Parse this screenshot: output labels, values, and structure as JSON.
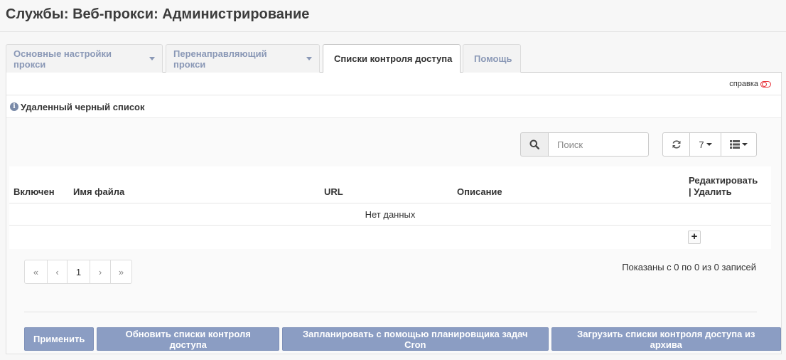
{
  "page": {
    "title": "Службы: Веб-прокси: Администрирование"
  },
  "tabs": [
    {
      "label": "Основные настройки прокси",
      "has_dropdown": true
    },
    {
      "label": "Перенаправляющий прокси",
      "has_dropdown": true
    },
    {
      "label": "Списки контроля доступа",
      "active": true
    },
    {
      "label": "Помощь"
    }
  ],
  "help": {
    "label": "справка"
  },
  "section": {
    "title": "Удаленный черный список"
  },
  "search": {
    "placeholder": "Поиск"
  },
  "toolbar": {
    "page_size": "7"
  },
  "grid": {
    "columns": [
      "Включен",
      "Имя файла",
      "URL",
      "Описание",
      "Редактировать",
      "| Удалить"
    ],
    "empty_text": "Нет данных"
  },
  "pager": {
    "first": "«",
    "prev": "‹",
    "current": "1",
    "next": "›",
    "last": "»",
    "info": "Показаны с 0 по 0 из 0 записей"
  },
  "actions": {
    "apply": "Применить",
    "update": "Обновить списки контроля доступа",
    "schedule": "Запланировать с помощью планировщика задач Cron",
    "download": "Загрузить списки контроля доступа из архива"
  },
  "colors": {
    "button": "#8b9dc3",
    "tab_inactive": "#8a98b6",
    "help_icon": "#e8333a"
  }
}
